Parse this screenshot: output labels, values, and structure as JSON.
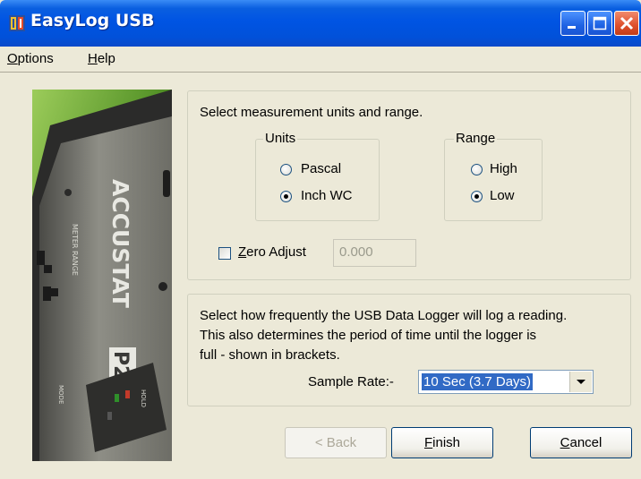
{
  "window": {
    "title": "EasyLog USB"
  },
  "menu": {
    "items": [
      {
        "label": "Options",
        "mnemonic": "O",
        "rest": "ptions"
      },
      {
        "label": "Help",
        "mnemonic": "H",
        "rest": "elp"
      }
    ]
  },
  "photo": {
    "device_name": "ACCUSTAT",
    "model": "P2",
    "label_meter_range": "METER RANGE",
    "label_mode": "MODE",
    "label_hold": "HOLD"
  },
  "units_panel": {
    "instruction": "Select measurement units and range.",
    "units_group": {
      "title": "Units",
      "options": [
        "Pascal",
        "Inch WC"
      ],
      "selected": "Inch WC"
    },
    "range_group": {
      "title": "Range",
      "options": [
        "High",
        "Low"
      ],
      "selected": "Low"
    },
    "zero_adjust": {
      "label": "Zero Adjust",
      "prefix": "Z",
      "rest": "ero Adjust",
      "checked": false,
      "value": "0.000"
    }
  },
  "rate_panel": {
    "instruction_line1": "Select how frequently the USB Data Logger will log a reading.",
    "instruction_line2": "This also determines the period of time until the logger is",
    "instruction_line3": "full - shown in brackets.",
    "sample_rate_label": "Sample Rate:-",
    "sample_rate_value": "10 Sec (3.7 Days)"
  },
  "buttons": {
    "back": "< Back",
    "finish": {
      "label": "Finish",
      "mnemonic": "F",
      "rest": "inish"
    },
    "cancel": {
      "label": "Cancel",
      "mnemonic": "C",
      "rest": "ancel"
    }
  }
}
